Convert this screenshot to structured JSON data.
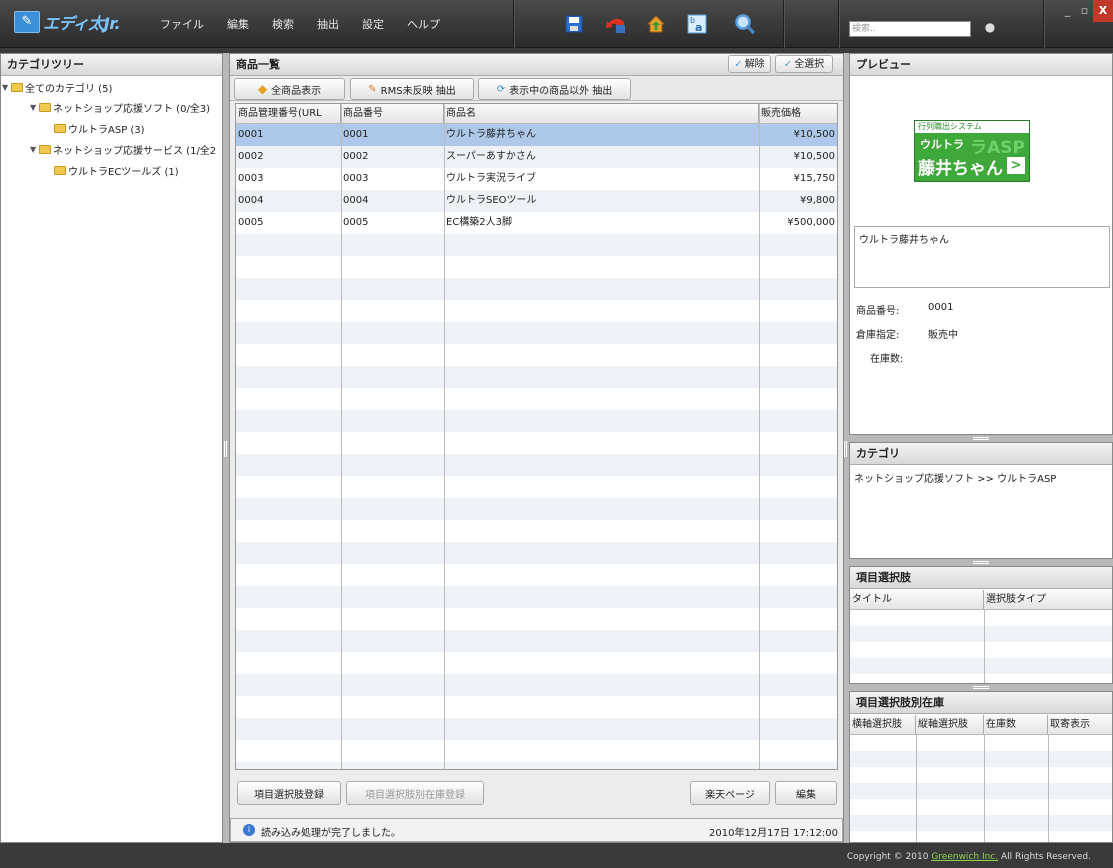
{
  "app": {
    "logo_text": "エディ太Jr.",
    "menu": [
      "ファイル",
      "編集",
      "検索",
      "抽出",
      "設定",
      "ヘルプ"
    ],
    "toolbar_icons": [
      "save-icon",
      "undo-icon",
      "home-upload-icon",
      "translate-icon",
      "zoom-icon"
    ],
    "search": {
      "placeholder": "検索.."
    },
    "window_buttons": [
      "_",
      "▫",
      "X"
    ]
  },
  "category_tree": {
    "title": "カテゴリツリー",
    "items": [
      {
        "label": "全てのカテゴリ (5)",
        "level": 0,
        "expanded": true
      },
      {
        "label": "ネットショップ応援ソフト (0/全3)",
        "level": 1,
        "expanded": true
      },
      {
        "label": "ウルトラASP (3)",
        "level": 2
      },
      {
        "label": "ネットショップ応援サービス (1/全2",
        "level": 1,
        "expanded": true
      },
      {
        "label": "ウルトラECツールズ (1)",
        "level": 2
      }
    ]
  },
  "product_list": {
    "title": "商品一覧",
    "deselect_label": "解除",
    "select_all_label": "全選択",
    "buttons": {
      "show_all": "全商品表示",
      "rms_extract": "RMS未反映 抽出",
      "extract_others": "表示中の商品以外 抽出"
    },
    "columns": [
      "商品管理番号(URL",
      "商品番号",
      "商品名",
      "販売価格"
    ],
    "rows": [
      {
        "mgmt": "0001",
        "num": "0001",
        "name": "ウルトラ藤井ちゃん",
        "price": "¥10,500",
        "selected": true
      },
      {
        "mgmt": "0002",
        "num": "0002",
        "name": "スーパーあすかさん",
        "price": "¥10,500"
      },
      {
        "mgmt": "0003",
        "num": "0003",
        "name": "ウルトラ実況ライブ",
        "price": "¥15,750"
      },
      {
        "mgmt": "0004",
        "num": "0004",
        "name": "ウルトラSEOツール",
        "price": "¥9,800"
      },
      {
        "mgmt": "0005",
        "num": "0005",
        "name": "EC構築2人3脚",
        "price": "¥500,000"
      }
    ],
    "bottom_buttons": {
      "option_register": "項目選択肢登録",
      "stock_register": "項目選択肢別在庫登録",
      "rakuten_page": "楽天ページ",
      "edit": "編集"
    },
    "status": {
      "message": "読み込み処理が完了しました。",
      "datetime": "2010年12月17日 17:12:00"
    }
  },
  "preview": {
    "title": "プレビュー",
    "banner": {
      "caption": "行列職出システム",
      "line1": "ウルトラ",
      "line2": "藤井ちゃん",
      "bg_text": "ラASP"
    },
    "name": "ウルトラ藤井ちゃん",
    "fields": [
      {
        "label": "商品番号:",
        "value": "0001"
      },
      {
        "label": "倉庫指定:",
        "value": "販売中"
      },
      {
        "label": "在庫数:",
        "value": ""
      }
    ]
  },
  "category_panel": {
    "title": "カテゴリ",
    "path": "ネットショップ応援ソフト >> ウルトラASP"
  },
  "option_panel": {
    "title": "項目選択肢",
    "columns": [
      "タイトル",
      "選択肢タイプ"
    ]
  },
  "stock_panel": {
    "title": "項目選択肢別在庫",
    "columns": [
      "横軸選択肢",
      "縦軸選択肢",
      "在庫数",
      "取寄表示"
    ]
  },
  "footer": {
    "prefix": "Copyright © 2010 ",
    "company": "Greenwich Inc.",
    "suffix": " All Rights Reserved."
  }
}
